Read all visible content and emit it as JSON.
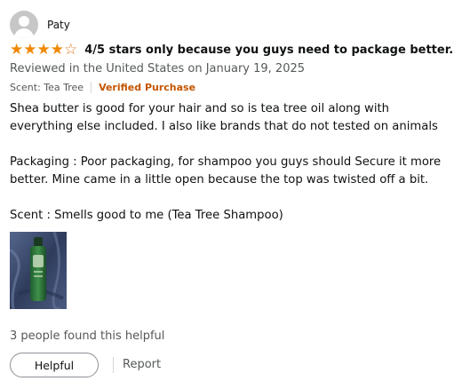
{
  "reviewer": {
    "name": "Paty",
    "avatar_icon": "default-user-avatar-icon"
  },
  "rating": {
    "value": 4,
    "max": 5,
    "color": "#f08804"
  },
  "review": {
    "title": "4/5 stars only because you guys need to package better.",
    "date_line": "Reviewed in the United States on January 19, 2025",
    "variant": "Scent: Tea Tree",
    "verified_label": "Verified Purchase",
    "body": [
      "Shea butter is good for your hair and so is tea tree oil along with everything else included. I also like brands that do not tested on animals",
      "Packaging : Poor packaging, for shampoo you guys should Secure it more better. Mine came in a little open because the top was twisted off a bit.",
      "Scent : Smells good to me (Tea Tree Shampoo)"
    ]
  },
  "helpful_count_text": "3 people found this helpful",
  "actions": {
    "helpful_label": "Helpful",
    "report_label": "Report"
  },
  "colors": {
    "verified": "#c45500",
    "muted_text": "#565959"
  }
}
